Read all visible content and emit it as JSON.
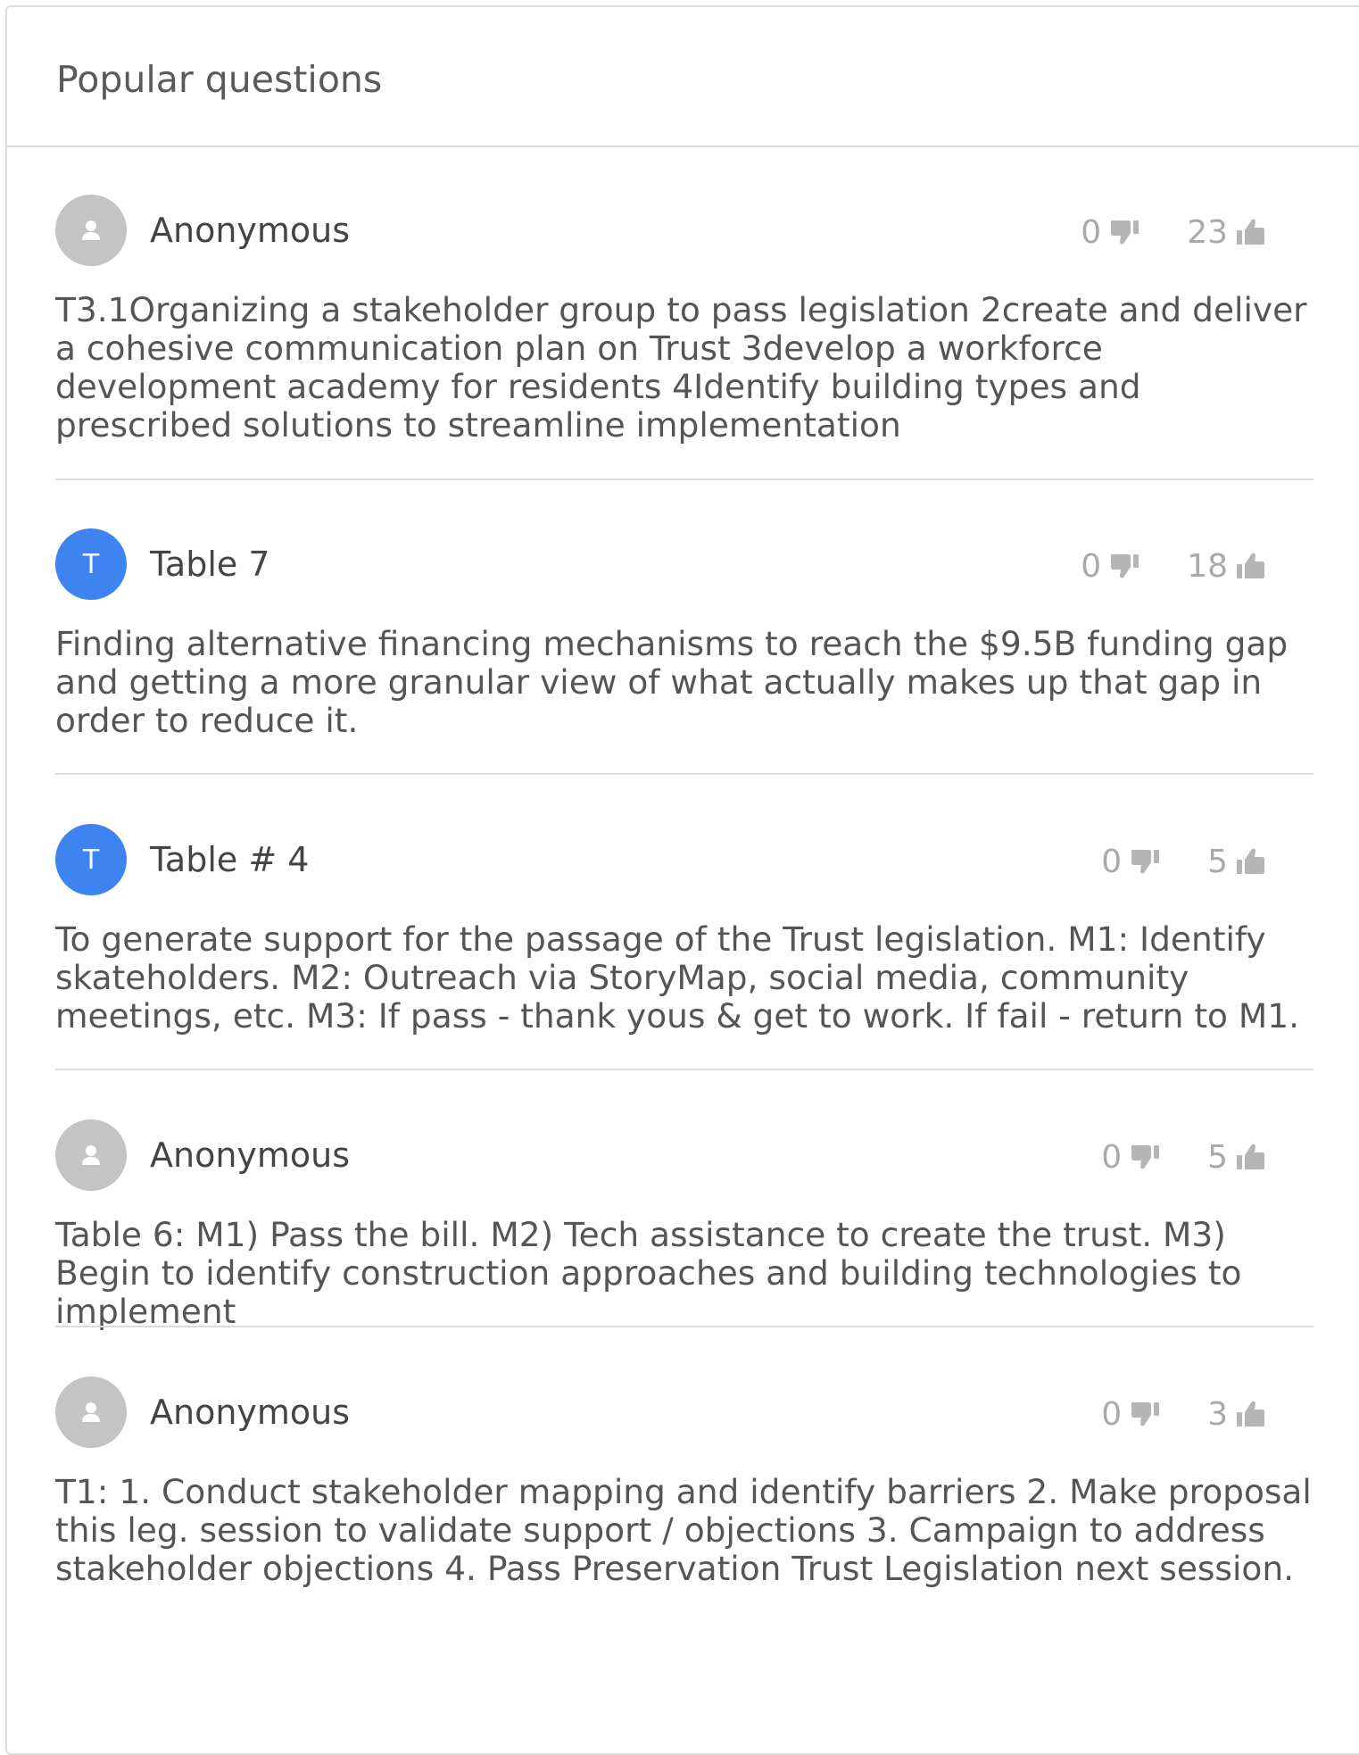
{
  "panel": {
    "title": "Popular questions"
  },
  "questions": [
    {
      "author": "Anonymous",
      "avatar_type": "anonymous",
      "avatar_letter": "",
      "dislikes": "0",
      "likes": "23",
      "text": "T3.1Organizing a stakeholder group to pass legislation 2create and deliver a cohesive communication plan on Trust 3develop a workforce development academy for residents 4Identify building types and prescribed solutions to streamline implementation"
    },
    {
      "author": "Table 7",
      "avatar_type": "letter",
      "avatar_letter": "T",
      "dislikes": "0",
      "likes": "18",
      "text": "Finding alternative financing mechanisms to reach the $9.5B funding gap and getting a more granular view of what actually makes up that gap in order to reduce it."
    },
    {
      "author": "Table # 4",
      "avatar_type": "letter",
      "avatar_letter": "T",
      "dislikes": "0",
      "likes": "5",
      "text": "To generate support for the passage of the Trust legislation. M1: Identify skateholders. M2: Outreach via StoryMap, social media, community meetings, etc. M3: If pass - thank yous & get to work. If fail - return to M1."
    },
    {
      "author": "Anonymous",
      "avatar_type": "anonymous",
      "avatar_letter": "",
      "dislikes": "0",
      "likes": "5",
      "text": "Table 6: M1) Pass the bill. M2) Tech assistance to create the trust. M3) Begin to identify construction approaches and building technologies to implement"
    },
    {
      "author": "Anonymous",
      "avatar_type": "anonymous",
      "avatar_letter": "",
      "dislikes": "0",
      "likes": "3",
      "text": "T1: 1. Conduct stakeholder mapping and identify barriers 2. Make proposal this leg. session to validate support / objections 3. Campaign to address stakeholder objections 4. Pass Preservation Trust Legislation next session."
    }
  ],
  "icons": {
    "anonymous_avatar": "person-icon",
    "dislike": "thumbs-down-icon",
    "like": "thumbs-up-icon"
  },
  "colors": {
    "anonymous_avatar": "#c4c4c4",
    "letter_avatar": "#3d84f0",
    "vote_gray": "#a9a9a9",
    "divider": "#dcdcdc"
  }
}
